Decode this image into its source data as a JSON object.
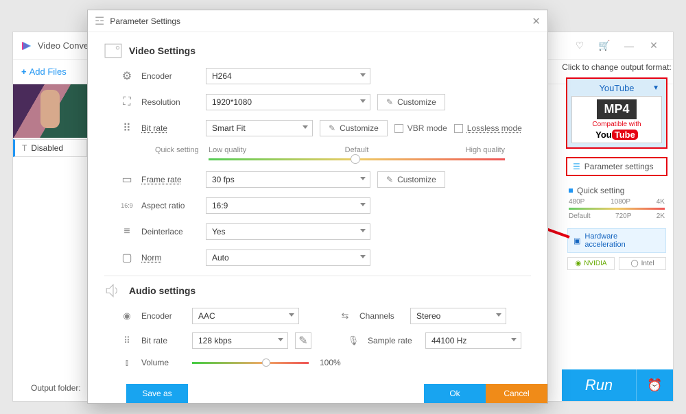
{
  "app": {
    "title": "Video Conve",
    "add_files": "Add Files",
    "disabled": "Disabled",
    "output_folder_label": "Output folder:"
  },
  "title_icons": {
    "minimize": "—",
    "close": "✕"
  },
  "dialog": {
    "title": "Parameter Settings",
    "video_section": "Video Settings",
    "audio_section": "Audio settings",
    "rows": {
      "encoder": {
        "label": "Encoder",
        "value": "H264"
      },
      "resolution": {
        "label": "Resolution",
        "value": "1920*1080",
        "customize": "Customize"
      },
      "bitrate": {
        "label": "Bit rate",
        "value": "Smart Fit",
        "customize": "Customize",
        "vbr": "VBR mode",
        "lossless": "Lossless mode"
      },
      "quick": {
        "label": "Quick setting",
        "low": "Low quality",
        "default": "Default",
        "high": "High quality"
      },
      "framerate": {
        "label": "Frame rate",
        "value": "30 fps",
        "customize": "Customize"
      },
      "aspect": {
        "label": "Aspect ratio",
        "value": "16:9"
      },
      "deinterlace": {
        "label": "Deinterlace",
        "value": "Yes"
      },
      "norm": {
        "label": "Norm",
        "value": "Auto"
      }
    },
    "audio": {
      "encoder": {
        "label": "Encoder",
        "value": "AAC"
      },
      "bitrate": {
        "label": "Bit rate",
        "value": "128 kbps"
      },
      "channels": {
        "label": "Channels",
        "value": "Stereo"
      },
      "samplerate": {
        "label": "Sample rate",
        "value": "44100 Hz"
      },
      "volume": {
        "label": "Volume",
        "percent": "100%"
      }
    },
    "buttons": {
      "save_as": "Save as",
      "ok": "Ok",
      "cancel": "Cancel"
    }
  },
  "side": {
    "change_label": "Click to change output format:",
    "youtube": "YouTube",
    "mp4": "MP4",
    "compat": "Compatible with",
    "you": "You",
    "tube": "Tube",
    "param_settings": "Parameter settings",
    "quick_setting": "Quick setting",
    "resolutions_top": [
      "480P",
      "1080P",
      "4K"
    ],
    "resolutions_bottom": [
      "Default",
      "720P",
      "2K"
    ],
    "hw_accel": "Hardware acceleration",
    "nvidia": "NVIDIA",
    "intel": "Intel",
    "run": "Run"
  }
}
